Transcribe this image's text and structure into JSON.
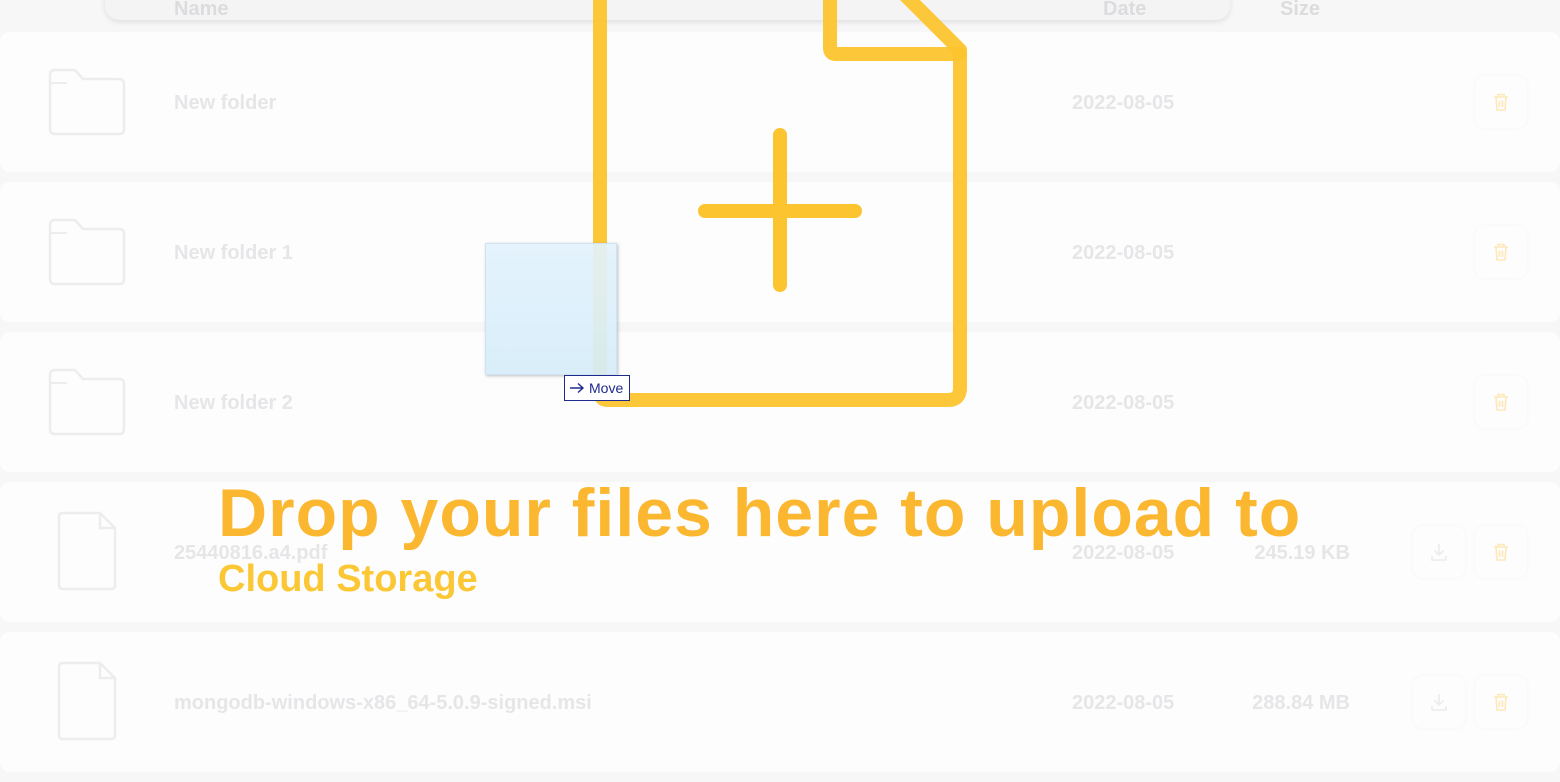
{
  "header": {
    "name_label": "Name",
    "date_label": "Date",
    "size_label": "Size"
  },
  "files": [
    {
      "icon": "folder-icon",
      "name": "New folder",
      "date": "2022-08-05",
      "size": "",
      "download": false
    },
    {
      "icon": "folder-icon",
      "name": "New folder 1",
      "date": "2022-08-05",
      "size": "",
      "download": false
    },
    {
      "icon": "folder-icon",
      "name": "New folder 2",
      "date": "2022-08-05",
      "size": "",
      "download": false
    },
    {
      "icon": "file-icon",
      "name": "25440816.a4.pdf",
      "date": "2022-08-05",
      "size": "245.19 KB",
      "download": true
    },
    {
      "icon": "file-icon",
      "name": "mongodb-windows-x86_64-5.0.9-signed.msi",
      "date": "2022-08-05",
      "size": "288.84 MB",
      "download": true
    }
  ],
  "drop_overlay": {
    "title": "Drop your files here to upload to",
    "subtitle": "Cloud Storage",
    "icon": "file-plus-icon"
  },
  "drag_tooltip": {
    "label": "Move",
    "icon": "arrow-right-icon"
  },
  "colors": {
    "accent": "#fbb72f",
    "accent_light": "#fcc735",
    "tooltip_text": "#1e2a8c"
  }
}
